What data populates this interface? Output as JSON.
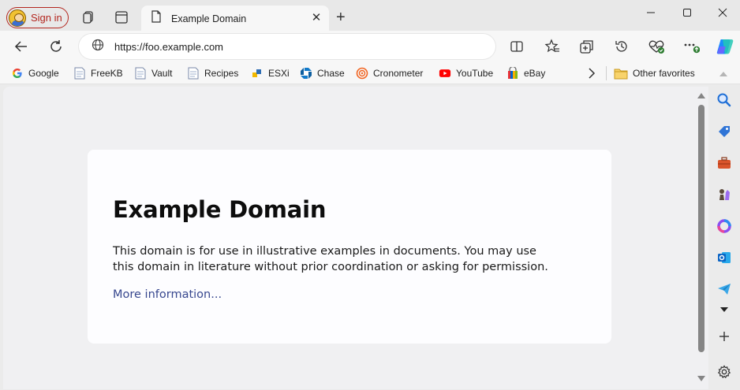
{
  "browser": {
    "signin_label": "Sign in",
    "tab_title": "Example Domain",
    "url": "https://foo.example.com"
  },
  "favorites": [
    {
      "label": "Google",
      "icon": "google-icon"
    },
    {
      "label": "FreeKB",
      "icon": "page-icon"
    },
    {
      "label": "Vault",
      "icon": "page-icon"
    },
    {
      "label": "Recipes",
      "icon": "page-icon"
    },
    {
      "label": "ESXi",
      "icon": "esxi-icon"
    },
    {
      "label": "Chase",
      "icon": "chase-icon"
    },
    {
      "label": "Cronometer",
      "icon": "cronometer-icon"
    },
    {
      "label": "YouTube",
      "icon": "youtube-icon"
    },
    {
      "label": "eBay",
      "icon": "ebay-icon"
    }
  ],
  "other_favorites_label": "Other favorites",
  "page": {
    "heading": "Example Domain",
    "paragraph": "This domain is for use in illustrative examples in documents. You may use this domain in literature without prior coordination or asking for permission.",
    "link": "More information..."
  },
  "colors": {
    "accent_red": "#b3261e",
    "link": "#38488f",
    "page_background": "#f0f0f2"
  }
}
